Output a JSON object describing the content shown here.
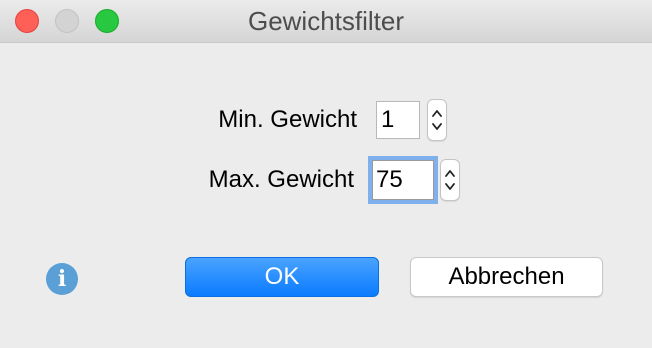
{
  "window": {
    "title": "Gewichtsfilter",
    "buttons": [
      "close",
      "minimize",
      "zoom"
    ]
  },
  "form": {
    "min_label": "Min. Gewicht",
    "min_value": "1",
    "max_label": "Max. Gewicht",
    "max_value": "75"
  },
  "icons": {
    "info": "info-icon",
    "info_glyph": "i"
  },
  "actions": {
    "ok_label": "OK",
    "cancel_label": "Abbrechen"
  },
  "colors": {
    "accent": "#0a7bff",
    "focus_ring": "#7fb0ec",
    "close": "#fe5f57",
    "zoom": "#28c840"
  }
}
